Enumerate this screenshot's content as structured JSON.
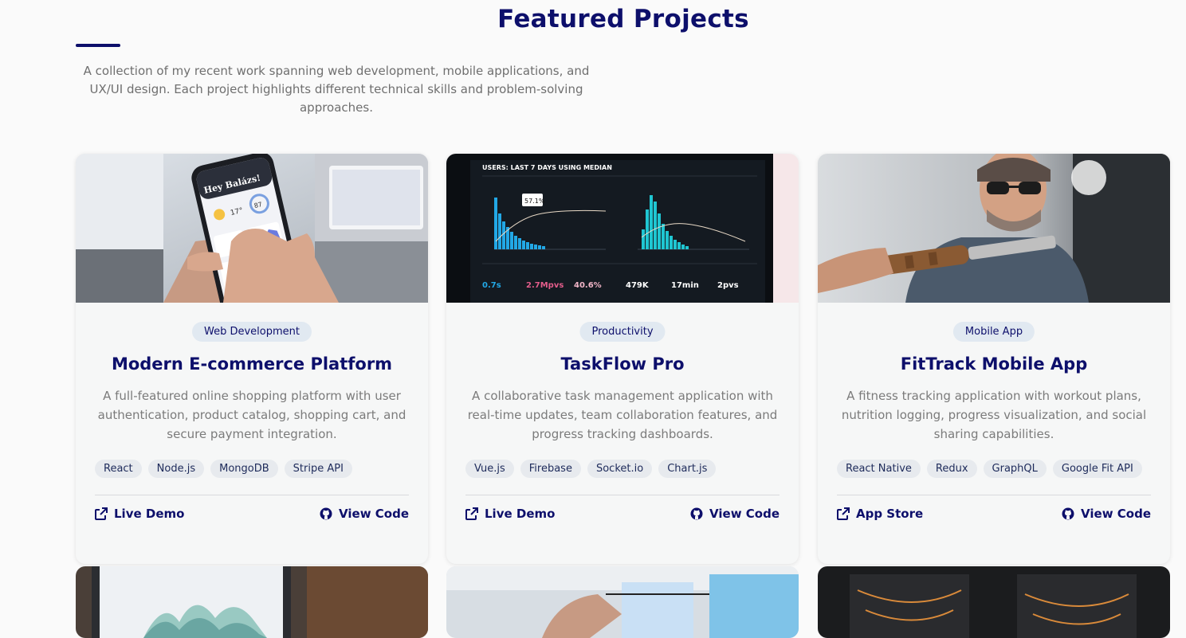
{
  "section": {
    "title": "Featured Projects",
    "intro": "A collection of my recent work spanning web development, mobile applications, and UX/UI design. Each project highlights different technical skills and problem-solving approaches."
  },
  "projects": [
    {
      "category": "Web Development",
      "title": "Modern E-commerce Platform",
      "description": "A full-featured online shopping platform with user authentication, product catalog, shopping cart, and secure payment integration.",
      "tags": [
        "React",
        "Node.js",
        "MongoDB",
        "Stripe API"
      ],
      "primary_link": "Live Demo",
      "code_link": "View Code",
      "image": {
        "greeting": "Hey Balázs!",
        "temp": "17°",
        "gauge": "87"
      }
    },
    {
      "category": "Productivity",
      "title": "TaskFlow Pro",
      "description": "A collaborative task management application with real-time updates, team collaboration features, and progress tracking dashboards.",
      "tags": [
        "Vue.js",
        "Firebase",
        "Socket.io",
        "Chart.js"
      ],
      "primary_link": "Live Demo",
      "code_link": "View Code",
      "image": {
        "header": "USERS: LAST 7 DAYS USING MEDIAN",
        "callout": "57.1%",
        "stats": [
          "0.7s",
          "2.7Mpvs",
          "40.6%",
          "479K",
          "17min",
          "2pvs"
        ]
      }
    },
    {
      "category": "Mobile App",
      "title": "FitTrack Mobile App",
      "description": "A fitness tracking application with workout plans, nutrition logging, progress visualization, and social sharing capabilities.",
      "tags": [
        "React Native",
        "Redux",
        "GraphQL",
        "Google Fit API"
      ],
      "primary_link": "App Store",
      "code_link": "View Code"
    }
  ],
  "colors": {
    "navy": "#0d0f6b",
    "badge_bg": "#e1e9f1",
    "tag_bg": "#e7eaee",
    "card_bg": "#f6f7f7"
  },
  "icons": {
    "external": "external-link-icon",
    "github": "github-icon"
  }
}
